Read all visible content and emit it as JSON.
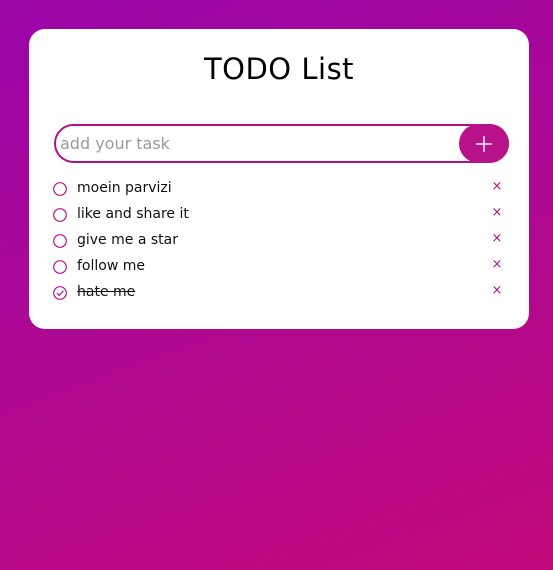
{
  "app": {
    "title": "TODO List"
  },
  "input": {
    "placeholder": "add your task",
    "value": ""
  },
  "icons": {
    "add": "plus-icon",
    "unchecked": "circle-icon",
    "checked": "check-circle-icon",
    "delete": "close-icon"
  },
  "colors": {
    "accent": "#b8128a",
    "background_start": "#9a06a8",
    "background_end": "#c1087a"
  },
  "tasks": [
    {
      "label": "moein parvizi",
      "done": false,
      "delete_glyph": "×"
    },
    {
      "label": "like and share it",
      "done": false,
      "delete_glyph": "×"
    },
    {
      "label": "give me a star",
      "done": false,
      "delete_glyph": "×"
    },
    {
      "label": "follow me",
      "done": false,
      "delete_glyph": "×"
    },
    {
      "label": "hate me",
      "done": true,
      "delete_glyph": "×"
    }
  ]
}
